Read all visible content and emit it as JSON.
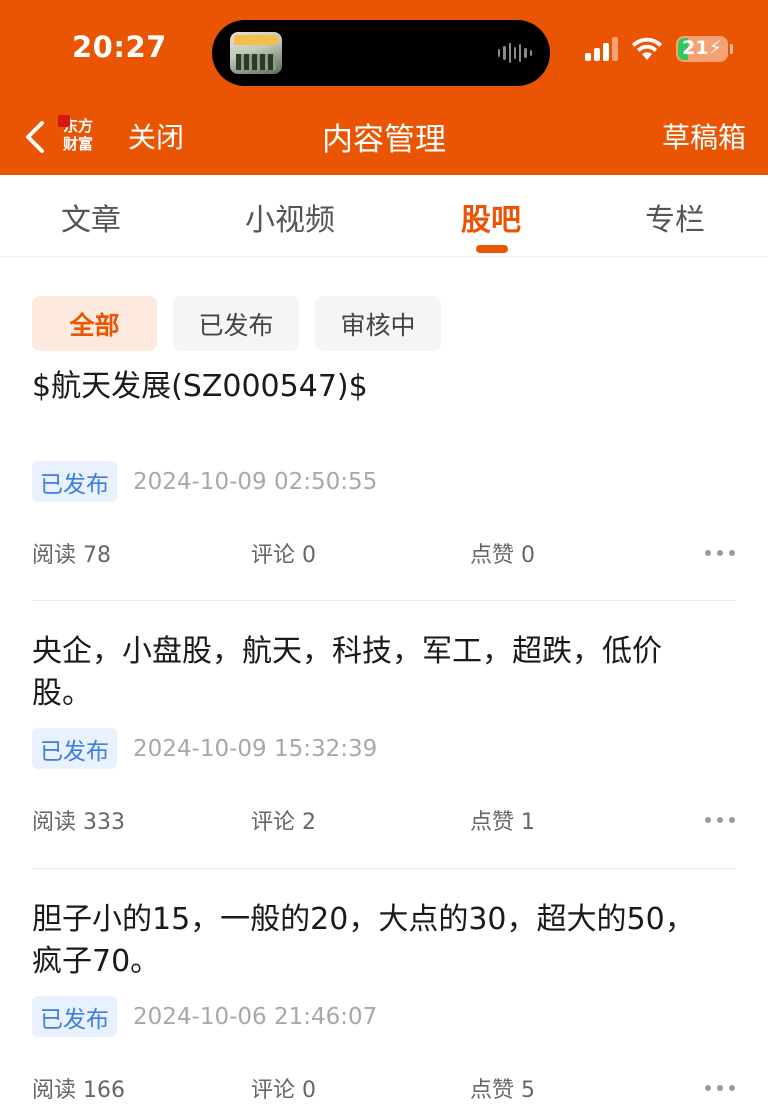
{
  "status_bar": {
    "time": "20:27",
    "battery": "21",
    "battery_level": 0.21
  },
  "nav": {
    "close_label": "关闭",
    "title": "内容管理",
    "drafts_label": "草稿箱",
    "logo_text": "东方财富"
  },
  "tabs": [
    {
      "label": "文章"
    },
    {
      "label": "小视频"
    },
    {
      "label": "股吧",
      "active": true
    },
    {
      "label": "专栏"
    }
  ],
  "filters": [
    {
      "label": "全部",
      "active": true
    },
    {
      "label": "已发布"
    },
    {
      "label": "审核中"
    }
  ],
  "posts": [
    {
      "title": "$航天发展(SZ000547)$",
      "status": "已发布",
      "date": "2024-10-09 02:50:55",
      "reads": "阅读 78",
      "comments": "评论 0",
      "likes": "点赞 0"
    },
    {
      "title": "央企，小盘股，航天，科技，军工，超跌，低价股。",
      "status": "已发布",
      "date": "2024-10-09 15:32:39",
      "reads": "阅读 333",
      "comments": "评论 2",
      "likes": "点赞 1"
    },
    {
      "title": "胆子小的15，一般的20，大点的30，超大的50，疯子70。",
      "status": "已发布",
      "date": "2024-10-06 21:46:07",
      "reads": "阅读 166",
      "comments": "评论 0",
      "likes": "点赞 5"
    }
  ],
  "colors": {
    "brand": "#ea5504",
    "badge_text": "#3d7ee0",
    "badge_bg": "#e8f1fd"
  }
}
